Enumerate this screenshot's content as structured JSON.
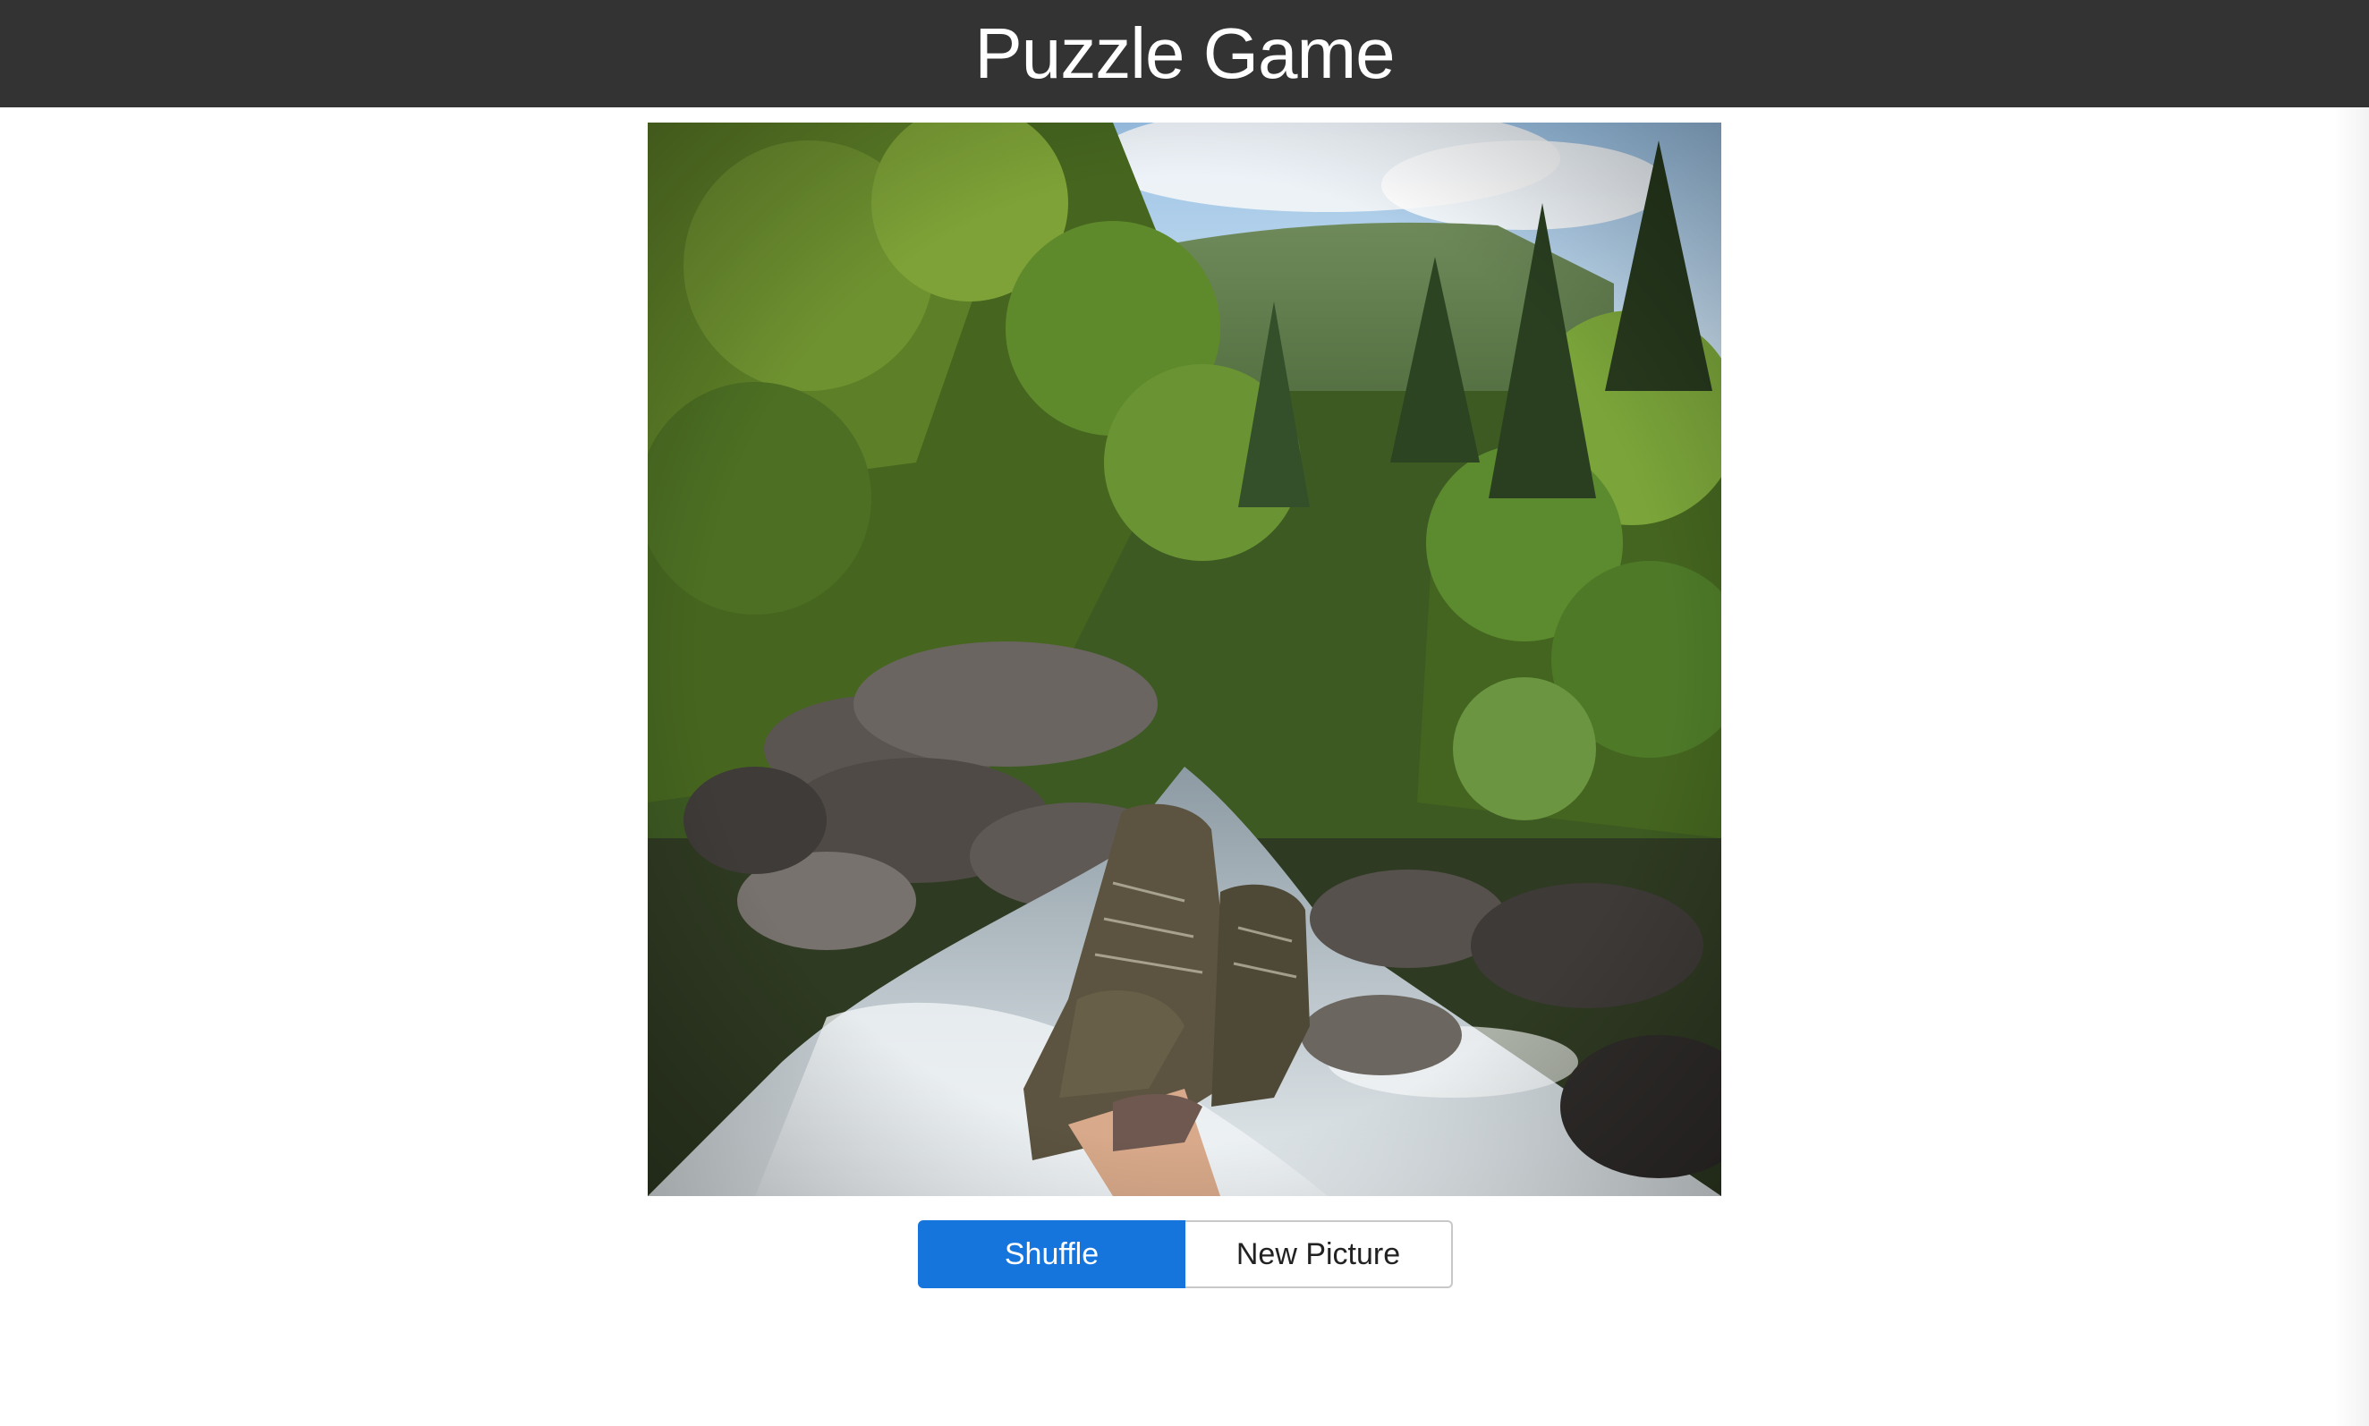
{
  "header": {
    "title": "Puzzle Game"
  },
  "puzzle": {
    "image_subject": "hiking boots over mountain stream with forest",
    "image_icon": "landscape-photo"
  },
  "controls": {
    "shuffle_label": "Shuffle",
    "new_picture_label": "New Picture"
  },
  "colors": {
    "header_bg": "#333333",
    "header_text": "#ffffff",
    "primary_button": "#1675dc",
    "secondary_border": "#c8c8c8"
  }
}
